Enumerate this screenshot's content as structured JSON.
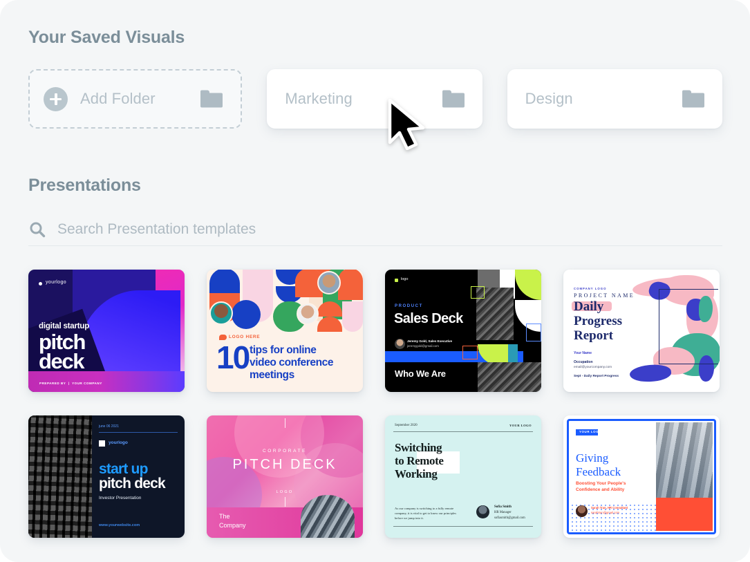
{
  "saved_section": {
    "title": "Your Saved Visuals",
    "folders": [
      {
        "label": "Add Folder",
        "type": "add",
        "icon": "folder-icon",
        "plus_icon": "plus-circle-icon"
      },
      {
        "label": "Marketing",
        "type": "folder",
        "icon": "folder-icon"
      },
      {
        "label": "Design",
        "type": "folder",
        "icon": "folder-icon"
      }
    ]
  },
  "presentations_section": {
    "title": "Presentations",
    "search": {
      "icon": "search-icon",
      "placeholder": "Search Presentation templates",
      "value": ""
    },
    "templates": [
      {
        "name": "digital-startup-pitch-deck",
        "logo": "yourlogo",
        "eyebrow": "digital startup",
        "title_line1": "pitch",
        "title_line2": "deck",
        "footer": "PREPARED BY  |  YOUR COMPANY"
      },
      {
        "name": "ten-tips-video-conference",
        "logo": "LOGO HERE",
        "number": "10",
        "title_line1": "tips for online",
        "title_line2": "video conference",
        "title_line3": "meetings"
      },
      {
        "name": "sales-deck",
        "logo": "logo",
        "eyebrow": "PRODUCT",
        "title": "Sales Deck",
        "author_name": "Jeremy Gold, Sales Executive",
        "author_email": "jeremygold@gmail.com",
        "footer": "Who We Are"
      },
      {
        "name": "daily-progress-report",
        "company": "COMPANY LOGO",
        "project": "PROJECT NAME",
        "title_line1": "Daily",
        "title_line2": "Progress",
        "title_line3": "Report",
        "your_name": "Your Name",
        "occupation": "Occupation",
        "email": "email@yourcompany.com",
        "note": "Sept - Daily Report Progress"
      },
      {
        "name": "start-up-pitch-deck",
        "date": "june 06 2021",
        "logo": "yourlogo",
        "title_line1": "start up",
        "title_line2": "pitch deck",
        "subtitle": "Investor Presentation",
        "website": "www.yourwebsite.com"
      },
      {
        "name": "corporate-pitch-deck",
        "eyebrow": "CORPORATE",
        "title": "PITCH DECK",
        "logo": "LOGO",
        "footer_line1": "The",
        "footer_line2": "Company"
      },
      {
        "name": "switching-to-remote-working",
        "date": "September 2020",
        "logo": "YOUR LOGO",
        "title_line1": "Switching",
        "title_line2": "to Remote",
        "title_line3": "Working",
        "body": "As our company is switching to a fully remote company, it is vital to get to know our principles before we jump into it.",
        "author_name": "Sofia Smith",
        "author_role": "HR Manager",
        "author_email": "sofiasmith@gmail.com"
      },
      {
        "name": "giving-feedback",
        "logo": "YOUR LOGO",
        "title_line1": "Giving",
        "title_line2": "Feedback",
        "subtitle_line1": "Boosting Your People's",
        "subtitle_line2": "Confidence and Ability",
        "author_name": "Sarah Tran, HR Consultant",
        "author_email": "sarahtran@gmail.com"
      }
    ]
  },
  "cursor": {
    "icon": "mouse-pointer-icon"
  },
  "colors": {
    "page_background": "#f4f6f7",
    "heading": "#7b8e99",
    "muted_text": "#b4c0c8",
    "card_white": "#ffffff",
    "accent_blue": "#1a5cff",
    "accent_orange": "#ff4f35",
    "accent_pink": "#e0379b"
  }
}
